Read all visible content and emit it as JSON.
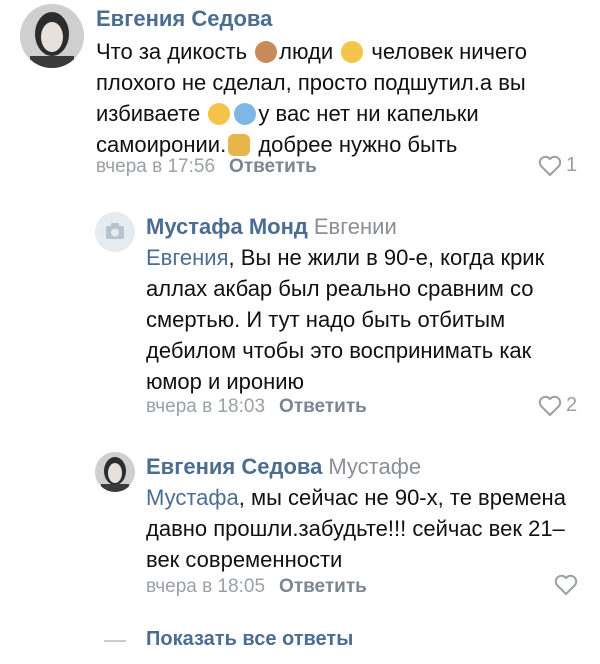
{
  "comments": [
    {
      "author": "Евгения Седова",
      "text_parts": [
        "Что за дикость",
        "люди",
        "человек ничего плохого не сделал, просто подшутил.а вы избиваете",
        "у вас нет ни капельки самоиронии.",
        "добрее нужно быть"
      ],
      "time": "вчера в 17:56",
      "reply_label": "Ответить",
      "likes": "1"
    },
    {
      "author": "Мустафа Монд",
      "reply_to": "Евгении",
      "mention": "Евгения",
      "text": ", Вы не жили в 90-е, когда крик аллах акбар был реально сравним со смертью. И тут надо быть отбитым дебилом чтобы это воспринимать как юмор и иронию",
      "time": "вчера в 18:03",
      "reply_label": "Ответить",
      "likes": "2"
    },
    {
      "author": "Евгения Седова",
      "reply_to": "Мустафе",
      "mention": "Мустафа",
      "text": ", мы сейчас не 90-х, те времена давно прошли.забудьте!!! сейчас век 21–век современности",
      "time": "вчера в 18:05",
      "reply_label": "Ответить",
      "likes": ""
    }
  ],
  "show_all_replies": "Показать все ответы",
  "icons": {
    "like": "heart-icon",
    "camera": "camera-icon",
    "emoji1": "see-no-evil-monkey-emoji",
    "emoji2": "sleepy-face-emoji",
    "emoji3": "grimacing-face-emoji",
    "emoji4": "cold-sweat-face-emoji",
    "emoji5": "person-facepalming-emoji"
  },
  "colors": {
    "link": "#4a6d91",
    "meta": "#9aa0a6"
  }
}
